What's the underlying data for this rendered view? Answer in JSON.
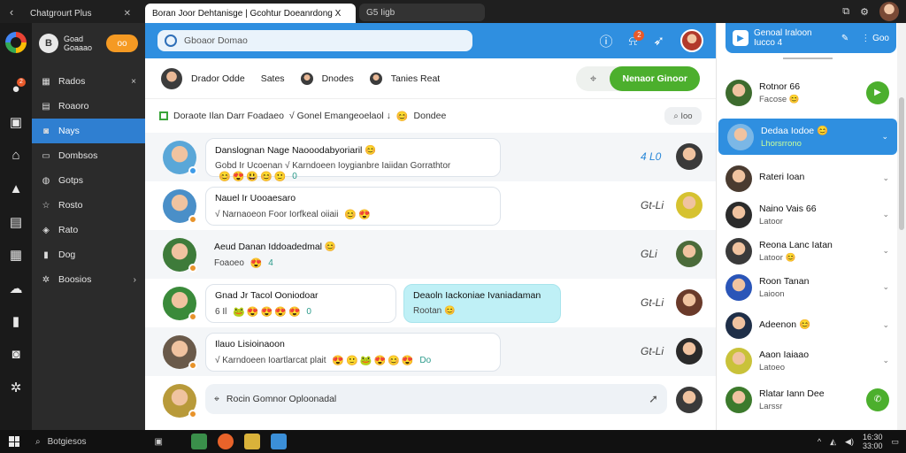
{
  "browser": {
    "tabs": [
      {
        "label": "Chatgrourt Plus"
      },
      {
        "label": "Boran Joor Dehtanisge | Gcohtur Doeanrdong X"
      },
      {
        "label": "G5 Iigb"
      }
    ]
  },
  "sidebar": {
    "title_line1": "Goad",
    "title_line2": "Goaaao",
    "app_icon_letter": "B",
    "toggle_label": "oo",
    "items": [
      {
        "label": "Rados",
        "icon": "grid-icon",
        "tail": "×"
      },
      {
        "label": "Roaoro",
        "icon": "doc-icon",
        "tail": ""
      },
      {
        "label": "Nays",
        "icon": "chat-icon",
        "tail": "",
        "active": true
      },
      {
        "label": "Dombsos",
        "icon": "folder-icon",
        "tail": ""
      },
      {
        "label": "Gotps",
        "icon": "people-icon",
        "tail": ""
      },
      {
        "label": "Rosto",
        "icon": "star-icon",
        "tail": ""
      },
      {
        "label": "Rato",
        "icon": "tag-icon",
        "tail": ""
      },
      {
        "label": "Dog",
        "icon": "bookmark-icon",
        "tail": ""
      },
      {
        "label": "Boosios",
        "icon": "gear-icon",
        "tail": "›"
      }
    ]
  },
  "rail": {
    "badge": "2"
  },
  "header": {
    "search_placeholder": "Gboaor Domao",
    "notification_badge": "2"
  },
  "people_bar": {
    "names": [
      "Drador Odde",
      "Sates",
      "Dnodes",
      "Tanies Reat"
    ],
    "primary_button": "Nenaor Ginoor"
  },
  "filter_bar": {
    "text_a": "Doraote Ilan Darr Foadaeo",
    "text_b": "√ Gonel Emangeoelaol ↓",
    "text_c": "Dondee",
    "right_label": "Ioo"
  },
  "messages": [
    {
      "title": "Danslognan Nage Naooodabyoriaril 😊",
      "line1": "Gobd Ir Ucoenan",
      "line2": "√ Karndoeen Ioygianbre Iaiidan Gorrathtor",
      "emoji": [
        "😊",
        "😍",
        "😃",
        "😊",
        "🙂"
      ],
      "count": "0",
      "meta": "4 L0"
    },
    {
      "title": "Nauel Ir Uooaesaro",
      "line1": "",
      "line2": "√ Narnaoeon Foor Iorfkeal oiiaii",
      "emoji": [
        "😊",
        "😍"
      ],
      "count": "",
      "meta": "Gt-Li"
    },
    {
      "title": "Aeud Danan Iddoadedmal 😊",
      "line1": "Foaoeo",
      "line2": "",
      "emoji": [
        "😍"
      ],
      "count": "4",
      "meta": "GLi"
    },
    {
      "title": "Gnad Jr Tacol Ooniodoar",
      "line1": "6 Il",
      "line2": "",
      "emoji": [
        "🐸",
        "😍",
        "😍",
        "😍",
        "😍"
      ],
      "count": "0",
      "meta": "Gt-Li",
      "reply_title": "Deaoln Iackoniae Ivaniadaman",
      "reply_sub": "Rootan 😊"
    },
    {
      "title": "Ilauo Lisioinaoon",
      "line1": "",
      "line2": "√ Karndoeen Ioartlarcat plait",
      "emoji": [
        "😍",
        "🙂",
        "🐸",
        "😍",
        "😊",
        "😍"
      ],
      "count": "Do",
      "meta": "Gt-Li"
    }
  ],
  "composer": {
    "placeholder": "Rocin Gomnor Oploonadal"
  },
  "right_panel": {
    "head_title_line1": "Genoal Iraloon",
    "head_title_line2": "Iucco 4",
    "head_tool": "Goo",
    "contacts": [
      {
        "name": "Rotnor 66",
        "sub": "Facose 😊",
        "tail": "play",
        "color": "#3d6b2e"
      },
      {
        "name": "Dedaa Iodoe 😊",
        "sub": "Lhorsrrono",
        "tail": "chev",
        "active": true,
        "color": "#7bb7e6"
      },
      {
        "name": "Rateri Ioan",
        "sub": "",
        "tail": "chev",
        "color": "#4a3b30"
      },
      {
        "name": "Naino Vais 66",
        "sub": "Latoor",
        "tail": "chev",
        "color": "#2b2b2b"
      },
      {
        "name": "Reona Lanc Iatan",
        "sub": "Latoor 😊",
        "tail": "chev",
        "color": "#3a3a3a"
      },
      {
        "name": "Roon Tanan",
        "sub": "Laioon",
        "tail": "chev",
        "color": "#2a55b8"
      },
      {
        "name": "Adeenon 😊",
        "sub": "",
        "tail": "chev",
        "color": "#1f2f48"
      },
      {
        "name": "Aaon Iaiaao",
        "sub": "Latoeo",
        "tail": "chev",
        "color": "#c9c23a"
      },
      {
        "name": "Rlatar Iann Dee",
        "sub": "Larssr",
        "tail": "phone",
        "color": "#3c7a2c"
      }
    ]
  },
  "taskbar": {
    "search_label": "Botgiesos",
    "time": "16:30",
    "date": "33:00"
  }
}
